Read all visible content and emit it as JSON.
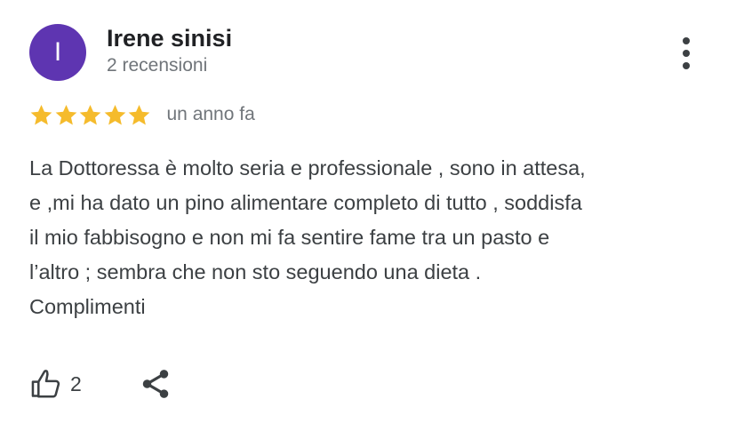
{
  "review": {
    "author_initial": "I",
    "author_name": "Irene sinisi",
    "author_review_count": "2 recensioni",
    "avatar_color": "#5e35b1",
    "rating": 5,
    "rating_max": 5,
    "star_color": "#f5bb2c",
    "date": "un anno fa",
    "text_lines": [
      "La Dottoressa è molto seria e professionale , sono in attesa,",
      "e ,mi ha dato un pino alimentare completo di tutto , soddisfa",
      "il mio fabbisogno e non mi fa sentire fame tra un pasto e",
      "l’altro ; sembra che non sto seguendo una dieta .",
      "Complimenti"
    ],
    "likes": "2"
  },
  "icons": {
    "more": "more-vert-icon",
    "like": "thumb-up-icon",
    "share": "share-icon",
    "star": "star-icon"
  }
}
